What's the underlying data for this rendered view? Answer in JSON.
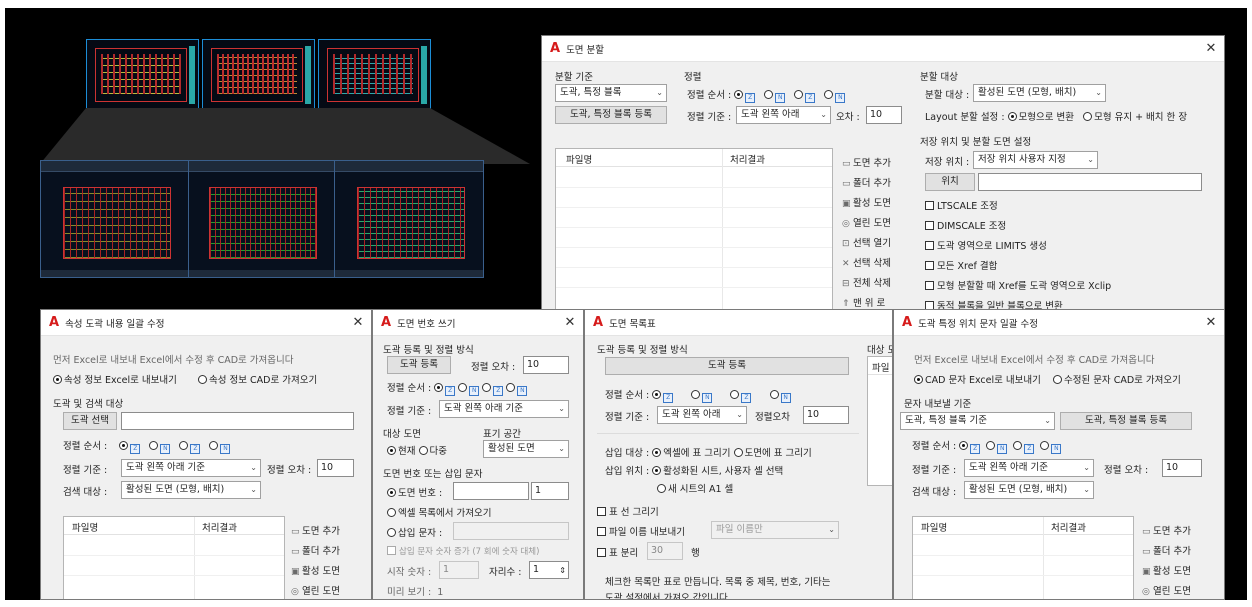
{
  "colors": {
    "autocad_red": "#d61b1b",
    "check_blue": "#3a78c8",
    "frame_black": "#000000"
  },
  "icons": {
    "app": "autocad-logo-icon",
    "close": "close-icon"
  },
  "w_split": {
    "title": "도면 분할",
    "criteria_group": "분할 기준",
    "criteria_value": "도곽, 특정 블록",
    "register_btn": "도곽, 특정 블록 등록",
    "sort_group": "정렬",
    "sort_order_label": "정렬 순서 :",
    "sort_base_label": "정렬 기준 :",
    "sort_base_value": "도곽 왼쪽 아래",
    "tolerance_label": "오차 :",
    "tolerance_value": "10",
    "target_group": "분할 대상",
    "target_label": "분할 대상 :",
    "target_value": "활성된 도면 (모형, 배치)",
    "layout_label": "Layout 분할 설정 :",
    "layout_opt1": "모형으로 변환",
    "layout_opt2": "모형 유지 + 배치 한 장",
    "save_group": "저장 위치 및 분할 도면 설정",
    "save_label": "저장 위치 :",
    "save_value": "저장 위치 사용자 지정",
    "location_btn": "위치",
    "options": [
      "LTSCALE 조정",
      "DIMSCALE 조정",
      "도곽 영역으로 LIMITS 생성",
      "모든 Xref 결합",
      "모형 분할할 때 Xref를 도곽 영역으로 Xclip",
      "동적 블록을 일반 블록으로 변환"
    ],
    "col_file": "파일명",
    "col_result": "처리결과",
    "side": [
      "도면 추가",
      "폴더 추가",
      "활성 도면",
      "열린 도면",
      "선택 열기",
      "선택 삭제",
      "전체 삭제",
      "맨 위 로"
    ]
  },
  "w_attr": {
    "title": "속성 도곽 내용 일괄 수정",
    "hint": "먼저 Excel로 내보내 Excel에서 수정 후 CAD로 가져옵니다",
    "opt_export": "속성 정보 Excel로 내보내기",
    "opt_import": "속성 정보 CAD로 가져오기",
    "group": "도곽 및 검색 대상",
    "select_btn": "도곽 선택",
    "sort_order_label": "정렬 순서 :",
    "sort_base_label": "정렬 기준 :",
    "sort_base_value": "도곽 왼쪽 아래 기준",
    "tolerance_label": "정렬 오차 :",
    "tolerance_value": "10",
    "search_label": "검색 대상 :",
    "search_value": "활성된 도면 (모형, 배치)",
    "col_file": "파일명",
    "col_result": "처리결과",
    "side": [
      "도면 추가",
      "폴더 추가",
      "활성 도면",
      "열린 도면"
    ]
  },
  "w_num": {
    "title": "도면 번호 쓰기",
    "group1": "도곽 등록 및 정렬 방식",
    "register_btn": "도곽 등록",
    "tolerance_label": "정렬 오차 :",
    "tolerance_value": "10",
    "sort_order_label": "정렬 순서 :",
    "sort_base_label": "정렬 기준 :",
    "sort_base_value": "도곽 왼쪽 아래 기준",
    "target_group": "대상 도면",
    "target_opt1": "현재",
    "target_opt2": "다중",
    "space_group": "표기 공간",
    "space_value": "활성된 도면",
    "num_group": "도면 번호 또는 삽입 문자",
    "opt_num": "도면 번호 :",
    "num_value": "1",
    "opt_excel": "엑셀 목록에서 가져오기",
    "opt_insert": "삽입 문자 :",
    "auto_inc": "삽입 문자 숫자 증가 (7 회에 숫자 대체)",
    "start_label": "시작 숫자 :",
    "start_value": "1",
    "digits_label": "자리수 :",
    "digits_value": "1",
    "preview_label": "미리 보기 :",
    "preview_value": "1"
  },
  "w_list": {
    "title": "도면 목록표",
    "group1": "도곽 등록 및 정렬 방식",
    "register_btn": "도곽 등록",
    "sort_order_label": "정렬 순서 :",
    "sort_base_label": "정렬 기준 :",
    "sort_base_value": "도곽 왼쪽 아래",
    "tolerance_label": "정렬오차",
    "tolerance_value": "10",
    "right_label": "대상 도",
    "right_col": "파일",
    "insert_target_label": "삽입 대상 :",
    "insert_opt1": "엑셀에 표 그리기",
    "insert_opt2": "도면에 표 그리기",
    "insert_pos_label": "삽입 위치 :",
    "pos_opt1": "활성화된 시트, 사용자 셀 선택",
    "pos_opt2": "새 시트의 A1 셀",
    "chk_line": "표 선 그리기",
    "chk_filename": "파일 이름 내보내기",
    "filename_value": "파일 이름만",
    "chk_split": "표 분리",
    "split_value": "30",
    "split_unit": "행",
    "footer1": "체크한 목록만 표로 만듭니다. 목록 중 제목, 번호, 기타는",
    "footer2": "도곽 설정에서 가져오 값입니다."
  },
  "w_text": {
    "title": "도곽 특정 위치 문자 일괄 수정",
    "hint": "먼저 Excel로 내보내 Excel에서 수정 후 CAD로 가져옵니다",
    "opt_export": "CAD 문자 Excel로 내보내기",
    "opt_import": "수정된 문자 CAD로 가져오기",
    "group": "문자 내보낼 기준",
    "criteria_value": "도곽, 특정 블록 기준",
    "register_btn": "도곽, 특정 블록 등록",
    "sort_order_label": "정렬 순서 :",
    "sort_base_label": "정렬 기준 :",
    "sort_base_value": "도곽 왼쪽 아래 기준",
    "tolerance_label": "정렬 오차 :",
    "tolerance_value": "10",
    "search_label": "검색 대상 :",
    "search_value": "활성된 도면 (모형, 배치)",
    "col_file": "파일명",
    "col_result": "처리결과",
    "side": [
      "도면 추가",
      "폴더 추가",
      "활성 도면",
      "열린 도면"
    ]
  }
}
